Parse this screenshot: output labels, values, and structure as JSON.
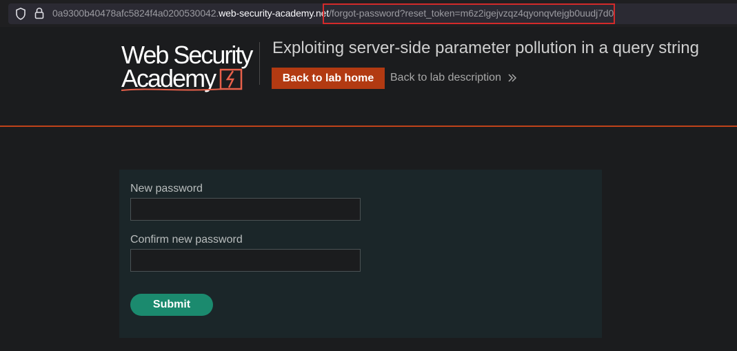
{
  "browser": {
    "url_subdomain": "0a9300b40478afc5824f4a0200530042.",
    "url_domain": "web-security-academy.net",
    "url_path": "/forgot-password?reset_token=m6z2igejvzqz4qyonqvtejgb0uudj7d0",
    "icons": [
      "shield-icon",
      "lock-icon"
    ]
  },
  "header": {
    "logo_line1": "Web Security",
    "logo_line2": "Academy",
    "lab_title": "Exploiting server-side parameter pollution in a query string",
    "back_home_label": "Back to lab home",
    "back_desc_label": "Back to lab description",
    "colors": {
      "accent": "#b23a12",
      "rule": "#c1431a"
    }
  },
  "form": {
    "new_password_label": "New password",
    "new_password_value": "",
    "confirm_password_label": "Confirm new password",
    "confirm_password_value": "",
    "submit_label": "Submit",
    "submit_color": "#1b8a6e"
  }
}
